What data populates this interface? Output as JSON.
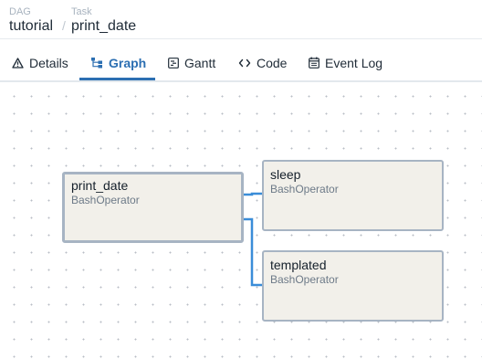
{
  "breadcrumb": {
    "dag_label": "DAG",
    "dag_value": "tutorial",
    "separator": "/",
    "task_label": "Task",
    "task_value": "print_date"
  },
  "tabs": [
    {
      "label": "Details",
      "icon": "warning-triangle-icon",
      "active": false
    },
    {
      "label": "Graph",
      "icon": "graph-icon",
      "active": true
    },
    {
      "label": "Gantt",
      "icon": "gantt-icon",
      "active": false
    },
    {
      "label": "Code",
      "icon": "code-icon",
      "active": false
    },
    {
      "label": "Event Log",
      "icon": "calendar-icon",
      "active": false
    }
  ],
  "graph": {
    "nodes": [
      {
        "id": "print_date",
        "title": "print_date",
        "operator": "BashOperator",
        "selected": true
      },
      {
        "id": "sleep",
        "title": "sleep",
        "operator": "BashOperator",
        "selected": false
      },
      {
        "id": "templated",
        "title": "templated",
        "operator": "BashOperator",
        "selected": false
      }
    ],
    "edges": [
      {
        "from": "print_date",
        "to": "sleep"
      },
      {
        "from": "print_date",
        "to": "templated"
      }
    ],
    "colors": {
      "edge": "#3a8dd8",
      "node_fill": "#f2f0ea",
      "node_border": "#a7b4c3",
      "accent": "#2c6fb2"
    }
  }
}
